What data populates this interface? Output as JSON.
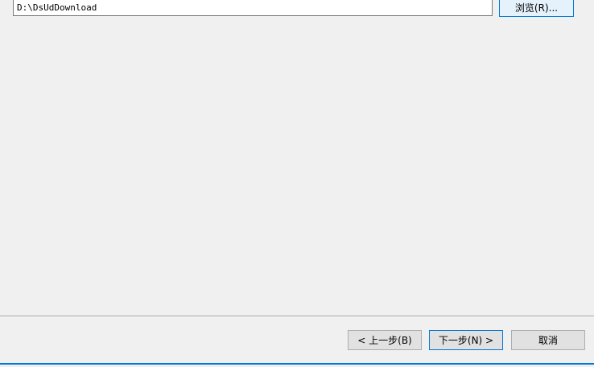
{
  "install_path": {
    "value": "D:\\DsUdDownload"
  },
  "browse_button": {
    "label": "浏览(R)..."
  },
  "footer": {
    "back_label": "< 上一步(B)",
    "next_label": "下一步(N) >",
    "cancel_label": "取消"
  },
  "colors": {
    "background": "#f0f0f0",
    "accent": "#0078d7",
    "button_face": "#e1e1e1"
  }
}
